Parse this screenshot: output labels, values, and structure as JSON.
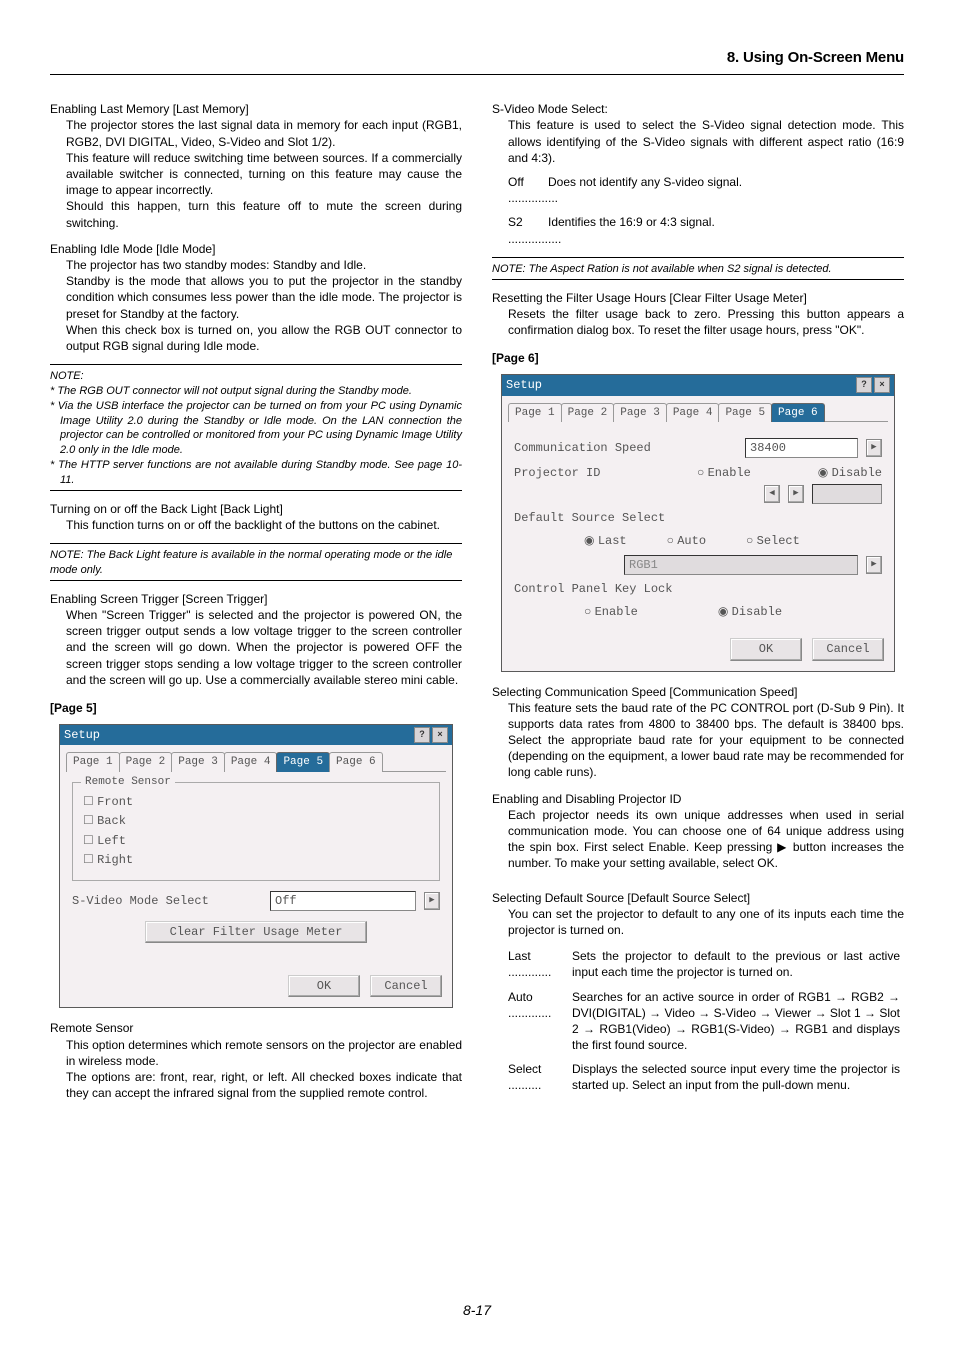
{
  "header": "8. Using On-Screen Menu",
  "page_number": "8-17",
  "left": {
    "s1": {
      "title": "Enabling Last Memory [Last Memory]",
      "b1": "The projector stores the last signal data in memory for each input (RGB1, RGB2, DVI DIGITAL, Video, S-Video and Slot 1/2).",
      "b2": "This feature will reduce switching time between sources. If a commercially available switcher is connected, turning on this feature may cause the image to appear incorrectly.",
      "b3": "Should this happen, turn this feature off to mute the screen during switching."
    },
    "s2": {
      "title": "Enabling Idle Mode [Idle Mode]",
      "b1": "The projector has two standby modes: Standby and Idle.",
      "b2": "Standby is the mode that allows you to put the projector in the standby condition which consumes less power than the idle mode. The projector is preset for Standby at the factory.",
      "b3": "When this check box is turned on, you allow the RGB OUT connector to output RGB signal during Idle mode."
    },
    "note1": {
      "h": "NOTE:",
      "l1": "* The RGB OUT connector will not output signal during the Standby mode.",
      "l2": "* Via the USB interface the projector can be turned on from your PC using Dynamic Image Utility 2.0 during the Standby or Idle mode. On the LAN connection the projector can be controlled or monitored from your PC using Dynamic Image Utility 2.0 only in the Idle mode.",
      "l3": "* The HTTP server functions are not available during Standby mode. See page 10-11."
    },
    "s3": {
      "title": "Turning on or off the Back Light [Back Light]",
      "b1": "This function turns on or off the backlight of the buttons on the cabinet."
    },
    "note2": "NOTE: The Back Light feature is available in the normal operating mode or the idle mode only.",
    "s4": {
      "title": "Enabling Screen Trigger [Screen Trigger]",
      "b1": "When \"Screen Trigger\" is selected and the projector is powered ON, the screen trigger output sends a low voltage trigger to the screen controller and the screen will go down. When the projector is powered OFF the screen trigger stops sending a low voltage trigger to the screen controller and the screen will go up. Use a commercially available stereo mini cable."
    },
    "page5_label": "[Page 5]",
    "osd5": {
      "title": "Setup",
      "tabs": [
        "Page 1",
        "Page 2",
        "Page 3",
        "Page 4",
        "Page 5",
        "Page 6"
      ],
      "active_tab": 4,
      "remote_sensor_label": "Remote Sensor",
      "front": "Front",
      "back": "Back",
      "left": "Left",
      "right": "Right",
      "svideo_label": "S-Video Mode Select",
      "svideo_value": "Off",
      "clear_btn": "Clear Filter Usage Meter",
      "ok": "OK",
      "cancel": "Cancel"
    },
    "s5": {
      "title": "Remote Sensor",
      "b1": "This option determines which remote sensors on the projector are enabled in wireless mode.",
      "b2": "The options are: front, rear, right, or left. All checked boxes indicate that they can accept the infrared signal from the supplied remote control."
    }
  },
  "right": {
    "r1": {
      "title": "S-Video Mode Select:",
      "b1": "This feature is used to select the S-Video signal detection mode. This allows identifying of the S-Video signals with different aspect ratio (16:9 and 4:3).",
      "off_l": "Off ...............",
      "off_r": "Does not identify any S-video signal.",
      "s2_l": "S2 ................",
      "s2_r": "Identifies the 16:9 or 4:3 signal."
    },
    "note3": "NOTE: The Aspect Ration is not available when S2 signal is detected.",
    "r2": {
      "title": "Resetting the Filter Usage Hours [Clear Filter Usage Meter]",
      "b1": "Resets the filter usage back to zero. Pressing this button appears a confirmation dialog box. To reset the filter usage hours, press \"OK\"."
    },
    "page6_label": "[Page 6]",
    "osd6": {
      "title": "Setup",
      "tabs": [
        "Page 1",
        "Page 2",
        "Page 3",
        "Page 4",
        "Page 5",
        "Page 6"
      ],
      "active_tab": 5,
      "comm_label": "Communication Speed",
      "comm_value": "38400",
      "projid_label": "Projector ID",
      "enable": "Enable",
      "disable": "Disable",
      "default_src_label": "Default Source Select",
      "last": "Last",
      "auto": "Auto",
      "select": "Select",
      "rgb1": "RGB1",
      "cpkl_label": "Control Panel Key Lock",
      "ok": "OK",
      "cancel": "Cancel"
    },
    "r3": {
      "title": "Selecting Communication Speed [Communication Speed]",
      "b1": "This feature sets the baud rate of the PC CONTROL port (D-Sub 9 Pin). It supports data rates from 4800 to 38400 bps. The default is 38400 bps. Select the appropriate baud rate for your equipment to be connected (depending on the equipment, a lower baud rate may be recommended for long cable runs)."
    },
    "r4": {
      "title": "Enabling and Disabling Projector ID",
      "b1": "Each projector needs its own unique addresses when used in serial communication mode. You can choose one of 64 unique address using the spin box. First select Enable. Keep pressing ▶ button increases the number. To make your setting available, select OK."
    },
    "r5": {
      "title": "Selecting Default Source [Default Source Select]",
      "b1": "You can set the projector to default to any one of its inputs each time the projector is turned on.",
      "last_l": "Last .............",
      "last_r": "Sets the projector to default to the previous or last active input each time the projector is turned on.",
      "auto_l": "Auto .............",
      "auto_r": "Searches for an active source in order of RGB1 → RGB2 → DVI(DIGITAL) → Video → S-Video → Viewer → Slot 1 → Slot 2 → RGB1(Video) → RGB1(S-Video) → RGB1 and displays the first found source.",
      "select_l": "Select ..........",
      "select_r": "Displays the selected source input every time the projector is started up. Select an input from the pull-down menu."
    }
  }
}
